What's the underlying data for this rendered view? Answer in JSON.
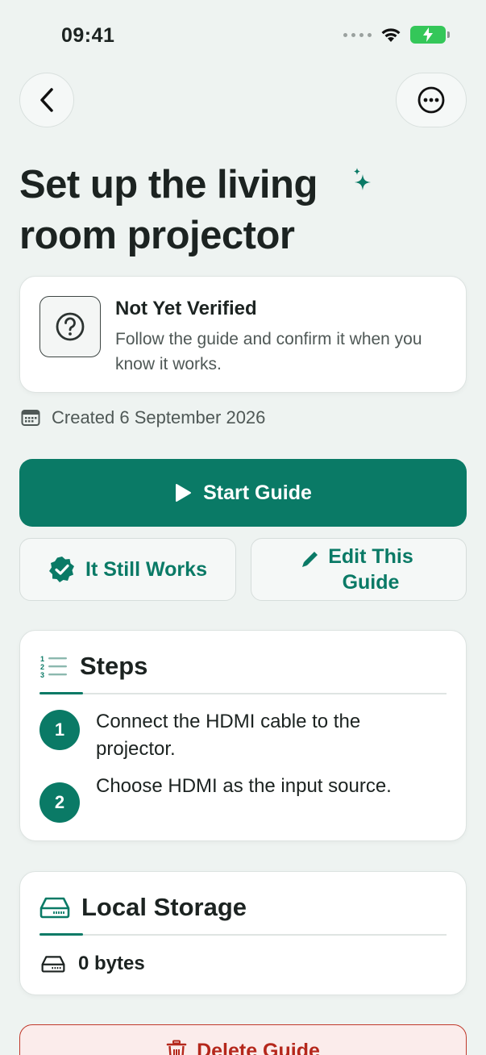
{
  "status_bar": {
    "time": "09:41"
  },
  "page": {
    "title": "Set up the living room projector"
  },
  "verification": {
    "title": "Not Yet Verified",
    "description": "Follow the guide and confirm it when you know it works."
  },
  "meta": {
    "created": "Created 6 September 2026"
  },
  "actions": {
    "start": "Start Guide",
    "still_works": "It Still Works",
    "edit": "Edit This Guide",
    "delete": "Delete Guide"
  },
  "steps_section": {
    "title": "Steps",
    "items": [
      {
        "number": "1",
        "text": "Connect the HDMI cable to the projector."
      },
      {
        "number": "2",
        "text": "Choose HDMI as the input source."
      }
    ]
  },
  "storage_section": {
    "title": "Local Storage",
    "size": "0 bytes"
  },
  "colors": {
    "accent": "#0a7a66",
    "background": "#eef3f1",
    "danger": "#b5281c",
    "battery": "#34c759"
  }
}
